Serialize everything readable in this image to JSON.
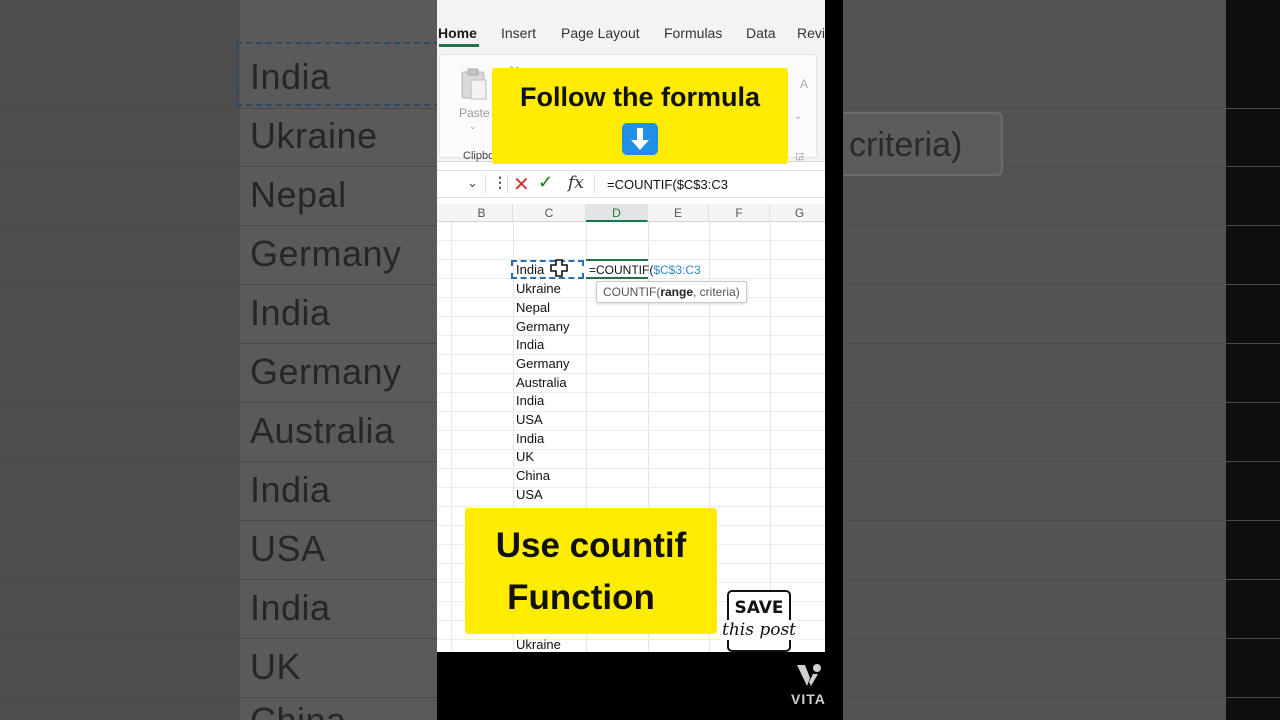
{
  "backdrop": {
    "words": [
      "India",
      "Ukraine",
      "Nepal",
      "Germany",
      "India",
      "Germany",
      "Australia",
      "India",
      "USA",
      "India",
      "UK",
      "China"
    ],
    "hint_fragment": "criteria)"
  },
  "ribbon": {
    "tabs": [
      "Home",
      "Insert",
      "Page Layout",
      "Formulas",
      "Data",
      "Revi"
    ],
    "active_tab": "Home",
    "paste_label": "Paste",
    "clipboard_label": "Clipbo"
  },
  "formula_bar": {
    "fx": "fx",
    "value": "=COUNTIF($C$3:C3"
  },
  "grid": {
    "columns": [
      "B",
      "C",
      "D",
      "E",
      "F",
      "G"
    ],
    "selected_column": "D",
    "cells_c": [
      "India",
      "Ukraine",
      "Nepal",
      "Germany",
      "India",
      "Germany",
      "Australia",
      "India",
      "USA",
      "India",
      "UK",
      "China",
      "USA"
    ],
    "bottom_cell": "Ukraine",
    "editing_prefix": "=COUNTIF(",
    "editing_ref": "$C$3:C3",
    "tooltip_fn": "COUNTIF(",
    "tooltip_arg1": "range",
    "tooltip_rest": ", criteria)"
  },
  "overlay": {
    "top_banner": "Follow the formula",
    "bottom_line1": "Use countif",
    "bottom_line2": "Function",
    "save_line1": "SAVE",
    "save_line2": "this post",
    "banner_color": "#ffec00"
  },
  "watermark": {
    "brand": "VITA"
  },
  "colors": {
    "excel_green": "#217346",
    "ref_blue": "#2d8ac7",
    "arrow_blue": "#1e90e8"
  }
}
